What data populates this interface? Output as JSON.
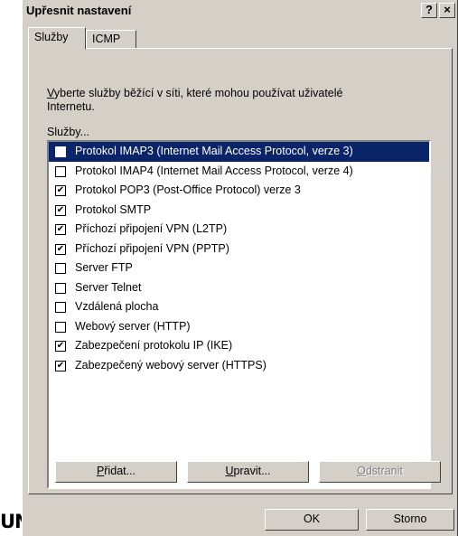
{
  "background": {
    "fragment_text": "UN"
  },
  "dialog": {
    "title": "Upřesnit nastavení",
    "help_button": "?",
    "close_button": "×",
    "tabs": [
      {
        "label": "Služby",
        "active": true
      },
      {
        "label": "ICMP",
        "active": false
      }
    ],
    "description": {
      "line1_first_char": "V",
      "line1_rest": "yberte služby běžící v síti, které mohou používat uživatelé",
      "line2": "Internetu."
    },
    "list_label": "Služby...",
    "services": [
      {
        "label": "Protokol IMAP3 (Internet Mail Access Protocol, verze 3)",
        "checked": false,
        "selected": true
      },
      {
        "label": "Protokol IMAP4 (Internet Mail Access Protocol, verze 4)",
        "checked": false,
        "selected": false
      },
      {
        "label": "Protokol POP3 (Post-Office Protocol) verze 3",
        "checked": true,
        "selected": false
      },
      {
        "label": "Protokol SMTP",
        "checked": true,
        "selected": false
      },
      {
        "label": "Příchozí připojení VPN (L2TP)",
        "checked": true,
        "selected": false
      },
      {
        "label": "Příchozí připojení VPN (PPTP)",
        "checked": true,
        "selected": false
      },
      {
        "label": "Server FTP",
        "checked": false,
        "selected": false
      },
      {
        "label": "Server Telnet",
        "checked": false,
        "selected": false
      },
      {
        "label": "Vzdálená plocha",
        "checked": false,
        "selected": false
      },
      {
        "label": "Webový server (HTTP)",
        "checked": false,
        "selected": false
      },
      {
        "label": "Zabezpečení protokolu IP (IKE)",
        "checked": true,
        "selected": false
      },
      {
        "label": "Zabezpečený webový server (HTTPS)",
        "checked": true,
        "selected": false
      }
    ],
    "buttons": {
      "add": {
        "first_char": "P",
        "rest": "řidat..."
      },
      "edit": {
        "first_char": "U",
        "rest": "pravit..."
      },
      "remove": {
        "first_char": "O",
        "rest": "dstranit",
        "disabled": true
      },
      "ok": "OK",
      "cancel": "Storno"
    },
    "colors": {
      "face": "#d4d0c8",
      "selection": "#0a246a",
      "disabled_text": "#808080"
    }
  }
}
